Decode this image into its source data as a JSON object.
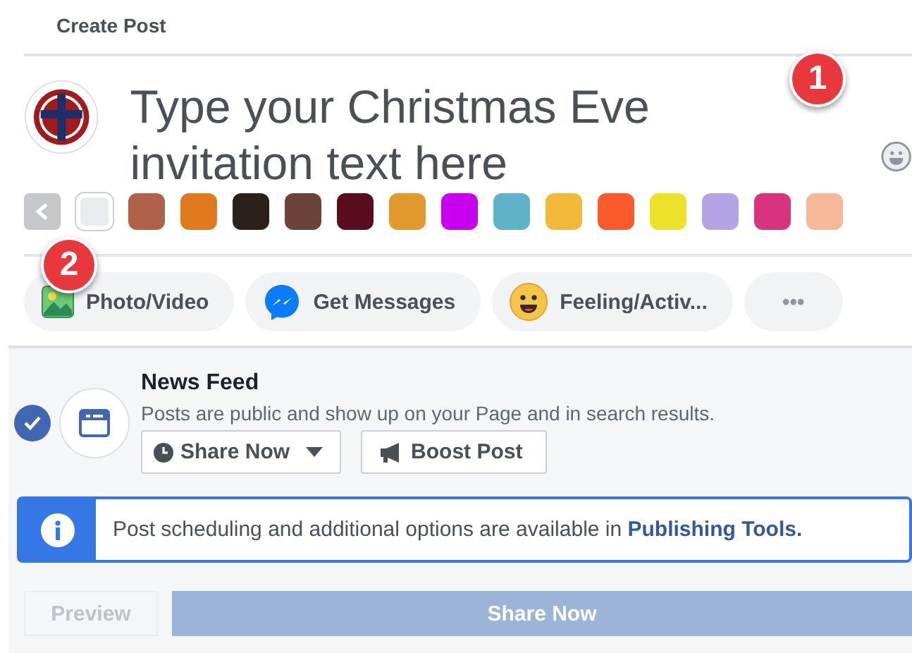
{
  "header": {
    "title": "Create Post"
  },
  "composer": {
    "placeholder": "Type your Christmas Eve invitation text here"
  },
  "backgrounds": [
    {
      "color": "#e9ebee",
      "selected": true
    },
    {
      "color": "#b0614a",
      "selected": false
    },
    {
      "color": "#e07a1f",
      "selected": false
    },
    {
      "color": "#2a211c",
      "selected": false
    },
    {
      "color": "#6b4338",
      "selected": false
    },
    {
      "color": "#5a0d20",
      "selected": false
    },
    {
      "color": "#e39a2c",
      "selected": false
    },
    {
      "color": "#c800f0",
      "selected": false
    },
    {
      "color": "#5fb3c9",
      "selected": false
    },
    {
      "color": "#f2b83a",
      "selected": false
    },
    {
      "color": "#fb5a2a",
      "selected": false
    },
    {
      "color": "#ece22a",
      "selected": false
    },
    {
      "color": "#b3a4e6",
      "selected": false
    },
    {
      "color": "#d8347e",
      "selected": false
    },
    {
      "color": "#f7b89a",
      "selected": false
    }
  ],
  "markers": [
    "1",
    "2"
  ],
  "actions": [
    {
      "kind": "photo",
      "label": "Photo/Video"
    },
    {
      "kind": "messenger",
      "label": "Get Messages"
    },
    {
      "kind": "feeling",
      "label": "Feeling/Activ..."
    },
    {
      "kind": "more",
      "label": "•••"
    }
  ],
  "destination": {
    "title": "News Feed",
    "description": "Posts are public and show up on your Page and in search results.",
    "checked": true,
    "share_label": "Share Now",
    "boost_label": "Boost Post"
  },
  "notice": {
    "text": "Post scheduling and additional options are available in ",
    "link": "Publishing Tools."
  },
  "footer": {
    "preview": {
      "label": "Preview",
      "disabled": true
    },
    "share": {
      "label": "Share Now",
      "disabled": true
    }
  }
}
